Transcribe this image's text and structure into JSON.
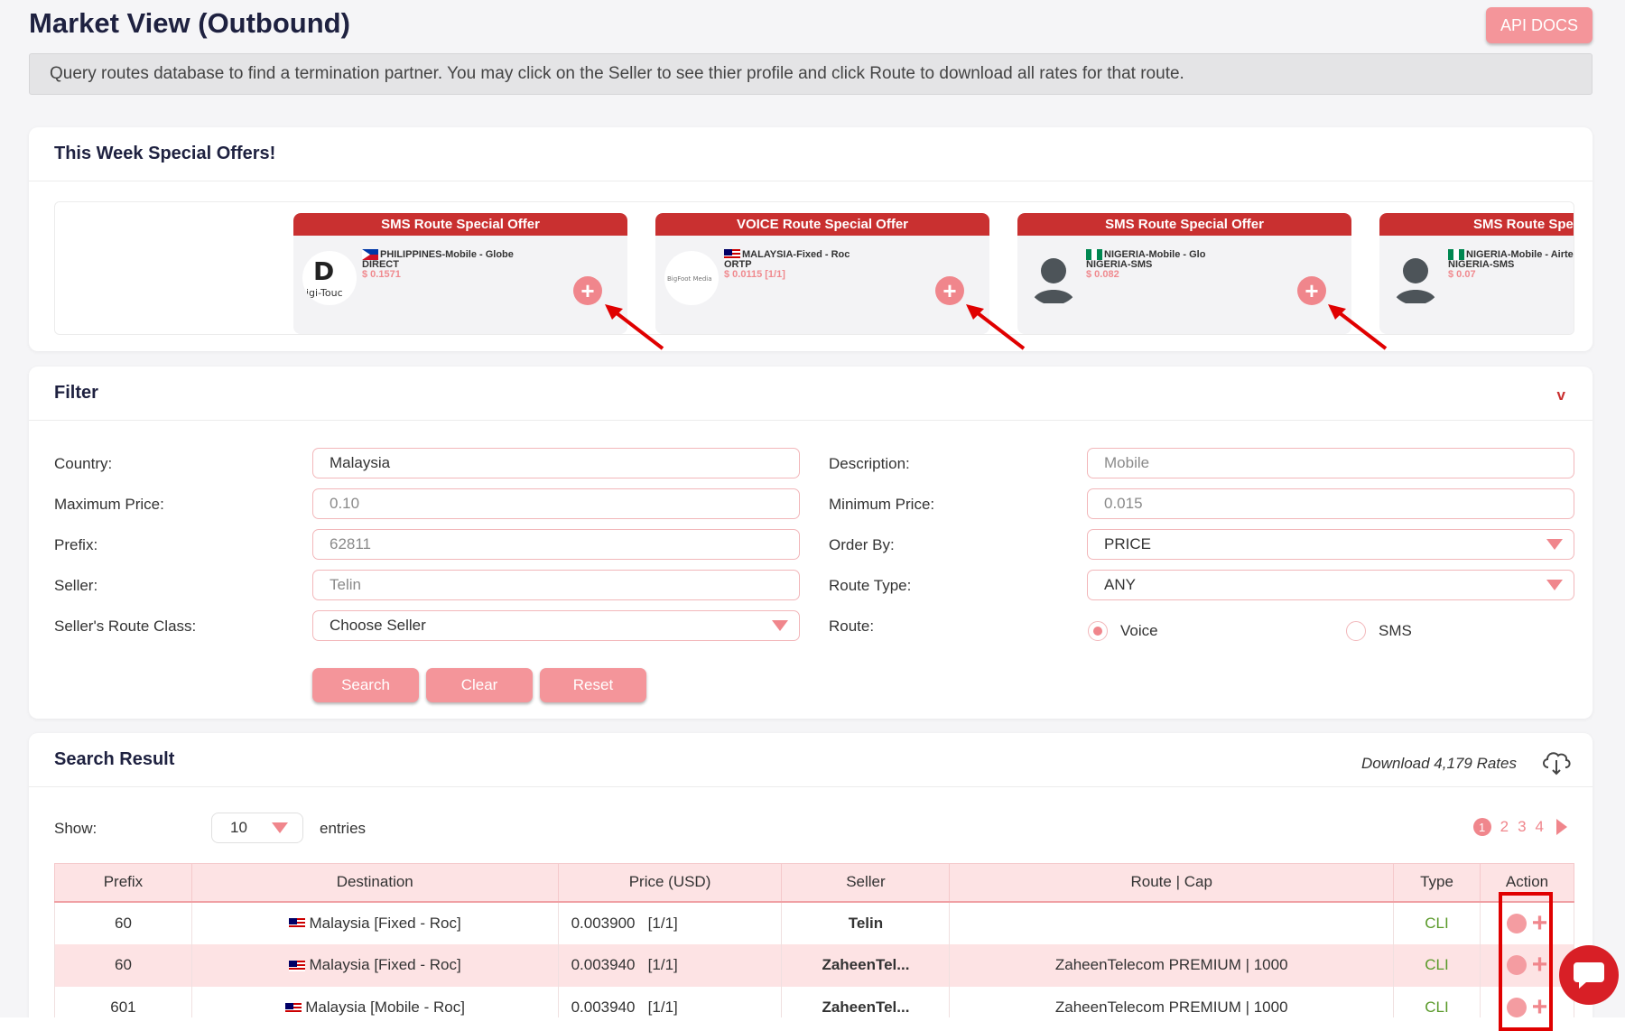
{
  "page": {
    "title": "Market View (Outbound)",
    "api_docs": "API DOCS",
    "info": "Query routes database to find a termination partner. You may click on the Seller to see thier profile and click Route to download all rates for that route."
  },
  "offers": {
    "title": "This Week Special Offers!",
    "items": [
      {
        "header": "SMS Route Special Offer",
        "dest": "PHILIPPINES-Mobile - Globe",
        "sub": "DIRECT",
        "price": "$ 0.1571",
        "logo": "Digi-Touch"
      },
      {
        "header": "VOICE Route Special Offer",
        "dest": "MALAYSIA-Fixed - Roc",
        "sub": "ORTP",
        "price": "$ 0.0115 [1/1]",
        "logo": "BigFoot Media"
      },
      {
        "header": "SMS Route Special Offer",
        "dest": "NIGERIA-Mobile - Glo",
        "sub": "NIGERIA-SMS",
        "price": "$ 0.082",
        "logo": "avatar"
      },
      {
        "header": "SMS Route Special Offer",
        "dest": "NIGERIA-Mobile - Airtel",
        "sub": "NIGERIA-SMS",
        "price": "$ 0.07",
        "logo": "avatar"
      }
    ]
  },
  "filter": {
    "title": "Filter",
    "collapse": "v",
    "country_label": "Country:",
    "country_value": "Malaysia",
    "max_price_label": "Maximum Price:",
    "max_price_placeholder": "0.10",
    "prefix_label": "Prefix:",
    "prefix_placeholder": "62811",
    "seller_label": "Seller:",
    "seller_placeholder": "Telin",
    "route_class_label": "Seller's Route Class:",
    "route_class_value": "Choose Seller",
    "description_label": "Description:",
    "description_placeholder": "Mobile",
    "min_price_label": "Minimum Price:",
    "min_price_placeholder": "0.015",
    "order_by_label": "Order By:",
    "order_by_value": "PRICE",
    "route_type_label": "Route Type:",
    "route_type_value": "ANY",
    "route_label": "Route:",
    "route_voice": "Voice",
    "route_sms": "SMS",
    "search": "Search",
    "clear": "Clear",
    "reset": "Reset"
  },
  "results": {
    "title": "Search Result",
    "download": "Download 4,179 Rates",
    "show_label": "Show:",
    "entries_value": "10",
    "entries_label": "entries",
    "pages": [
      "1",
      "2",
      "3",
      "4"
    ],
    "columns": [
      "Prefix",
      "Destination",
      "Price (USD)",
      "Seller",
      "Route | Cap",
      "Type",
      "Action"
    ],
    "rows": [
      {
        "prefix": "60",
        "destination": "Malaysia [Fixed - Roc]",
        "price": "0.003900",
        "ratio": "[1/1]",
        "seller": "Telin",
        "route": "",
        "type": "CLI"
      },
      {
        "prefix": "60",
        "destination": "Malaysia [Fixed - Roc]",
        "price": "0.003940",
        "ratio": "[1/1]",
        "seller": "ZaheenTel...",
        "route": "ZaheenTelecom PREMIUM | 1000",
        "type": "CLI"
      },
      {
        "prefix": "601",
        "destination": "Malaysia [Mobile - Roc]",
        "price": "0.003940",
        "ratio": "[1/1]",
        "seller": "ZaheenTel...",
        "route": "ZaheenTelecom PREMIUM | 1000",
        "type": "CLI"
      }
    ]
  }
}
